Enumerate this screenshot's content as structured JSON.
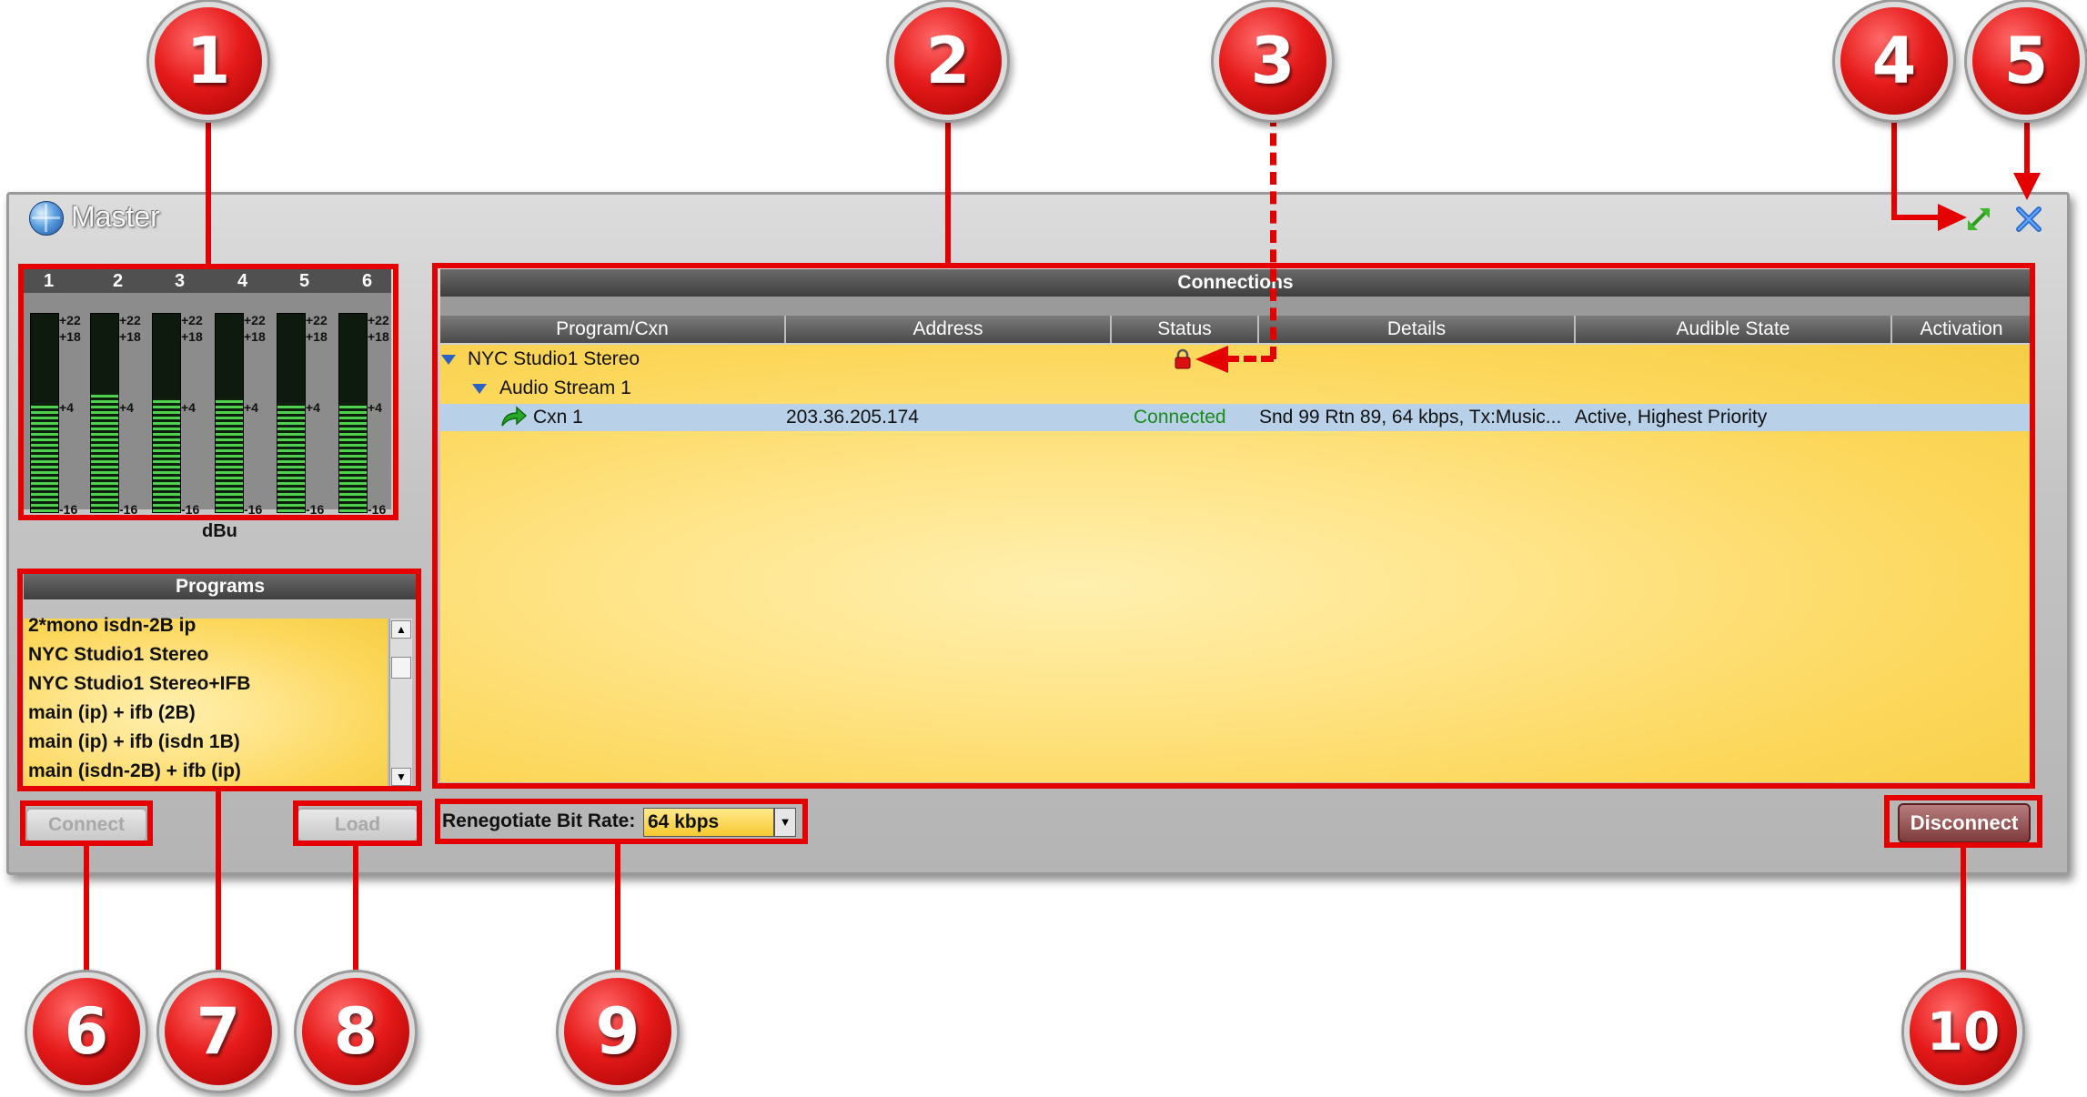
{
  "window": {
    "title": "Master"
  },
  "meters": {
    "channels": [
      "1",
      "2",
      "3",
      "4",
      "5",
      "6"
    ],
    "scale": [
      "+22",
      "+18",
      "+4",
      "-16"
    ],
    "unit": "dBu",
    "levels": [
      0.55,
      0.6,
      0.58,
      0.58,
      0.55,
      0.55
    ]
  },
  "programs": {
    "header": "Programs",
    "items": [
      "2*mono isdn-2B ip",
      "NYC Studio1 Stereo",
      "NYC Studio1 Stereo+IFB",
      "main (ip) + ifb (2B)",
      "main (ip) + ifb (isdn 1B)",
      "main (isdn-2B) + ifb (ip)"
    ]
  },
  "connections": {
    "header": "Connections",
    "columns": [
      "Program/Cxn",
      "Address",
      "Status",
      "Details",
      "Audible State",
      "Activation"
    ],
    "program_row": {
      "name": "NYC Studio1 Stereo"
    },
    "stream_row": {
      "name": "Audio Stream 1"
    },
    "cxn_row": {
      "name": "Cxn 1",
      "address": "203.36.205.174",
      "status": "Connected",
      "details": "Snd 99 Rtn 89, 64 kbps, Tx:Music...",
      "audible_state": "Active, Highest Priority"
    }
  },
  "buttons": {
    "connect": "Connect",
    "load": "Load",
    "disconnect": "Disconnect"
  },
  "bitrate": {
    "label": "Renegotiate Bit Rate:",
    "value": "64 kbps"
  },
  "callouts": [
    "1",
    "2",
    "3",
    "4",
    "5",
    "6",
    "7",
    "8",
    "9",
    "10"
  ],
  "colors": {
    "callout_red": "#e50000",
    "status_green": "#1a8a1a",
    "selected_row": "#b8d0e8"
  },
  "icons": {
    "window": "globe-icon",
    "maximize": "expand-arrows-icon",
    "close": "close-x-icon",
    "lock": "lock-icon",
    "connection": "green-arrow-icon",
    "expand": "triangle-down-icon"
  }
}
